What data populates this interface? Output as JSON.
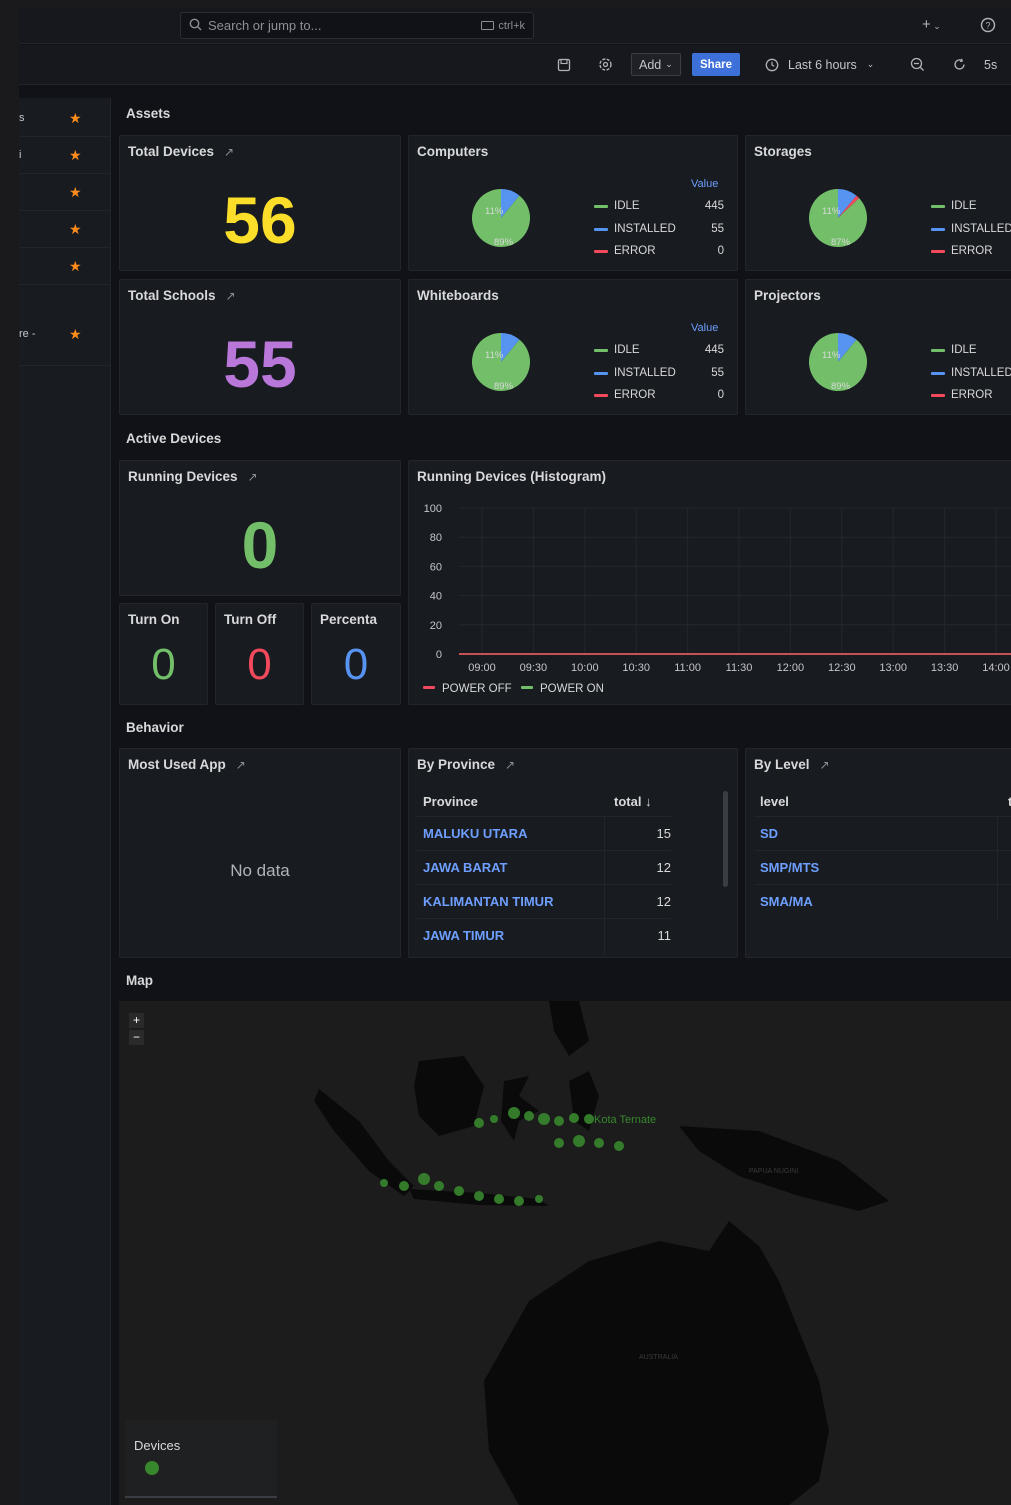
{
  "topbar": {
    "search_placeholder": "Search or jump to...",
    "search_shortcut": "ctrl+k",
    "plus_label": "+"
  },
  "toolbar": {
    "add_label": "Add",
    "share_label": "Share",
    "time_range": "Last 6 hours",
    "refresh_interval": "5s"
  },
  "sidebar": {
    "items": [
      {
        "label": "s"
      },
      {
        "label": "i"
      },
      {
        "label": ""
      },
      {
        "label": ""
      },
      {
        "label": ""
      },
      {
        "label": "re -"
      }
    ]
  },
  "sections": {
    "assets": "Assets",
    "active_devices": "Active Devices",
    "behavior": "Behavior",
    "map": "Map"
  },
  "panels": {
    "total_devices": {
      "title": "Total Devices",
      "value": "56",
      "color": "#fade2a"
    },
    "total_schools": {
      "title": "Total Schools",
      "value": "55",
      "color": "#b877d9"
    },
    "computers": {
      "title": "Computers",
      "legend_head": "Value",
      "idle": "IDLE",
      "idle_val": "445",
      "installed": "INSTALLED",
      "installed_val": "55",
      "error": "ERROR",
      "error_val": "0",
      "pct_small": "11%",
      "pct_large": "89%",
      "slice_blue": 0.11,
      "slice_red": 0.0
    },
    "storages": {
      "title": "Storages",
      "idle": "IDLE",
      "installed": "INSTALLED",
      "error": "ERROR",
      "pct_small": "11%",
      "pct_large": "87%",
      "slice_blue": 0.11,
      "slice_red": 0.02
    },
    "whiteboards": {
      "title": "Whiteboards",
      "legend_head": "Value",
      "idle": "IDLE",
      "idle_val": "445",
      "installed": "INSTALLED",
      "installed_val": "55",
      "error": "ERROR",
      "error_val": "0",
      "pct_small": "11%",
      "pct_large": "89%",
      "slice_blue": 0.11,
      "slice_red": 0.0
    },
    "projectors": {
      "title": "Projectors",
      "idle": "IDLE",
      "installed": "INSTALLED",
      "error": "ERROR",
      "pct_small": "11%",
      "pct_large": "89%",
      "slice_blue": 0.11,
      "slice_red": 0.0
    },
    "running_devices": {
      "title": "Running Devices",
      "value": "0",
      "color": "#73bf69"
    },
    "turn_on": {
      "title": "Turn On",
      "value": "0",
      "color": "#73bf69"
    },
    "turn_off": {
      "title": "Turn Off",
      "value": "0",
      "color": "#f2495c"
    },
    "percenta": {
      "title": "Percenta",
      "value": "0",
      "color": "#5794f2"
    },
    "histogram": {
      "title": "Running Devices (Histogram)"
    },
    "most_used_app": {
      "title": "Most Used App",
      "empty": "No data"
    },
    "by_province": {
      "title": "By Province",
      "col1": "Province",
      "col2": "total",
      "rows": [
        {
          "name": "MALUKU UTARA",
          "total": "15"
        },
        {
          "name": "JAWA BARAT",
          "total": "12"
        },
        {
          "name": "KALIMANTAN TIMUR",
          "total": "12"
        },
        {
          "name": "JAWA TIMUR",
          "total": "11"
        }
      ]
    },
    "by_level": {
      "title": "By Level",
      "col1": "level",
      "col2": "t",
      "rows": [
        {
          "name": "SD"
        },
        {
          "name": "SMP/MTS"
        },
        {
          "name": "SMA/MA"
        }
      ]
    },
    "map": {
      "zoom_in": "+",
      "zoom_out": "−",
      "legend_title": "Devices",
      "label_ternate": "Kota Ternate",
      "label_papua": "PAPUA NUGINI",
      "label_australia": "AUSTRALIA"
    }
  },
  "chart_data": {
    "type": "line",
    "x": [
      "09:00",
      "09:30",
      "10:00",
      "10:30",
      "11:00",
      "11:30",
      "12:00",
      "12:30",
      "13:00",
      "13:30",
      "14:00"
    ],
    "yticks": [
      "100",
      "80",
      "60",
      "40",
      "20",
      "0"
    ],
    "ylim": [
      0,
      100
    ],
    "series": [
      {
        "name": "POWER OFF",
        "color": "#f2495c",
        "values": [
          0,
          0,
          0,
          0,
          0,
          0,
          0,
          0,
          0,
          0,
          0
        ]
      },
      {
        "name": "POWER ON",
        "color": "#73bf69",
        "values": [
          0,
          0,
          0,
          0,
          0,
          0,
          0,
          0,
          0,
          0,
          0
        ]
      }
    ]
  },
  "colors": {
    "idle": "#73bf69",
    "installed": "#5794f2",
    "error": "#f2495c",
    "star": "#ff8c1a",
    "map_point": "#37872d"
  }
}
